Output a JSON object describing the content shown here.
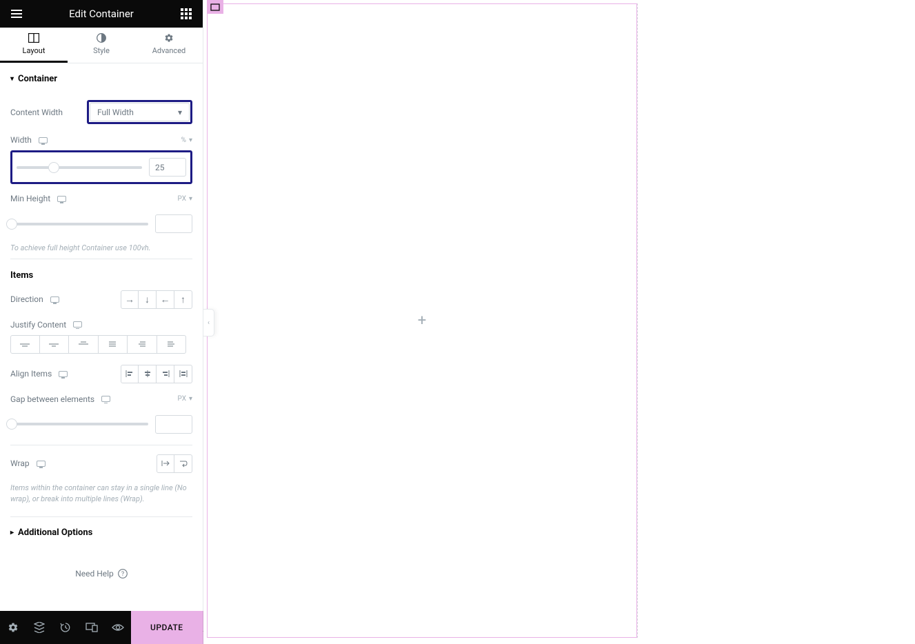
{
  "header": {
    "title": "Edit Container"
  },
  "tabs": {
    "layout": "Layout",
    "style": "Style",
    "advanced": "Advanced"
  },
  "sections": {
    "container": "Container",
    "additional": "Additional Options"
  },
  "contentWidth": {
    "label": "Content Width",
    "value": "Full Width"
  },
  "width": {
    "label": "Width",
    "unit": "%",
    "value": "25"
  },
  "minHeight": {
    "label": "Min Height",
    "unit": "PX",
    "hint": "To achieve full height Container use 100vh."
  },
  "items": {
    "heading": "Items"
  },
  "direction": {
    "label": "Direction"
  },
  "justify": {
    "label": "Justify Content"
  },
  "align": {
    "label": "Align Items"
  },
  "gap": {
    "label": "Gap between elements",
    "unit": "PX"
  },
  "wrap": {
    "label": "Wrap",
    "hint": "Items within the container can stay in a single line (No wrap), or break into multiple lines (Wrap)."
  },
  "help": {
    "label": "Need Help"
  },
  "footer": {
    "update": "UPDATE"
  },
  "canvas": {
    "plus": "+"
  }
}
